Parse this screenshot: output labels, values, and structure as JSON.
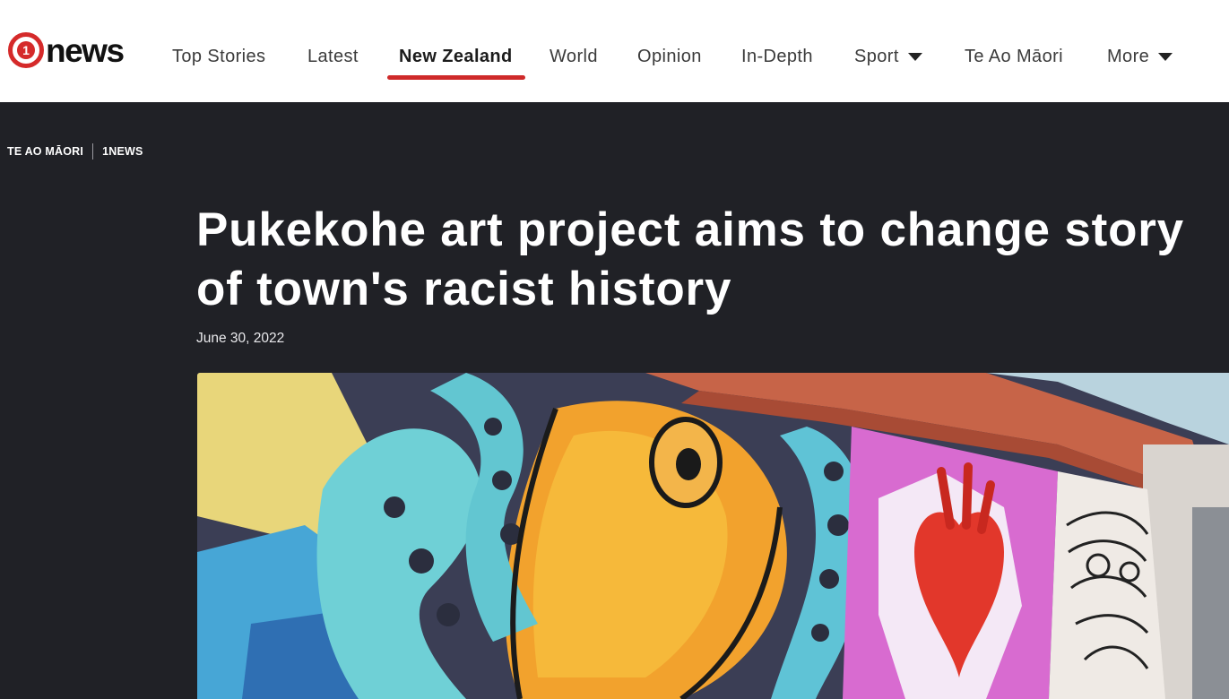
{
  "logo": {
    "number": "1",
    "text": "news"
  },
  "nav": {
    "items": [
      {
        "label": "Top Stories"
      },
      {
        "label": "Latest"
      },
      {
        "label": "New Zealand"
      },
      {
        "label": "World"
      },
      {
        "label": "Opinion"
      },
      {
        "label": "In-Depth"
      },
      {
        "label": "Sport"
      },
      {
        "label": "Te Ao Māori"
      },
      {
        "label": "More"
      }
    ],
    "active": "New Zealand"
  },
  "article": {
    "breadcrumb": {
      "section": "TE AO MĀORI",
      "source": "1NEWS"
    },
    "title_line1": "Pukekohe art project aims to change story",
    "title_line2": "of town's racist history",
    "date": "June 30, 2022"
  },
  "colors": {
    "accent": "#cf2a2a",
    "page_bg": "#202126",
    "header_bg": "#ffffff"
  }
}
